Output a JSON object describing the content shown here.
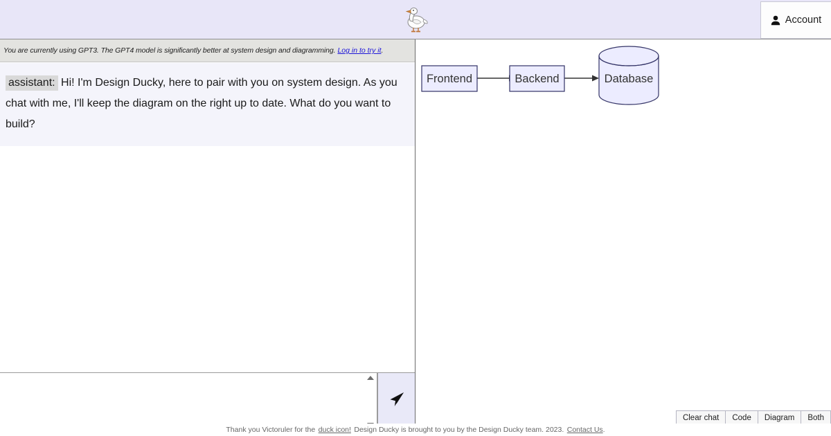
{
  "header": {
    "logo_icon": "duck-icon",
    "account": {
      "icon": "person-icon",
      "label": "Account"
    }
  },
  "notice": {
    "text": "You are currently using GPT3. The GPT4 model is significantly better at system design and diagramming.",
    "link_label": "Log in to try it",
    "link_color": "#1a12d8"
  },
  "chat": {
    "messages": [
      {
        "role": "assistant:",
        "text": "Hi! I'm Design Ducky, here to pair with you on system design. As you chat with me, I'll keep the diagram on the right up to date. What do you want to build?"
      }
    ]
  },
  "composer": {
    "input_value": "",
    "placeholder": "",
    "send_icon": "send-paper-plane-icon",
    "scroll_up_icon": "scroll-up-arrow-icon",
    "scroll_down_icon": "scroll-down-arrow-icon"
  },
  "diagram": {
    "nodes": [
      {
        "id": "frontend",
        "label": "Frontend",
        "shape": "rect"
      },
      {
        "id": "backend",
        "label": "Backend",
        "shape": "rect"
      },
      {
        "id": "database",
        "label": "Database",
        "shape": "cylinder"
      }
    ],
    "edges": [
      {
        "from": "frontend",
        "to": "backend"
      },
      {
        "from": "backend",
        "to": "database"
      }
    ],
    "node_fill": "#ececff",
    "node_stroke": "#9370db",
    "edge_color": "#333333",
    "label_color": "#333333"
  },
  "view_controls": {
    "buttons": [
      {
        "id": "clear-chat",
        "label": "Clear chat"
      },
      {
        "id": "code",
        "label": "Code"
      },
      {
        "id": "diagram",
        "label": "Diagram"
      },
      {
        "id": "both",
        "label": "Both"
      }
    ]
  },
  "footer": {
    "thanks_prefix": "Thank you Victoruler for the",
    "duck_link": "duck icon!",
    "middle_text": "Design Ducky is brought to you by the Design Ducky team. 2023.",
    "contact_link": "Contact Us",
    "period": "."
  }
}
